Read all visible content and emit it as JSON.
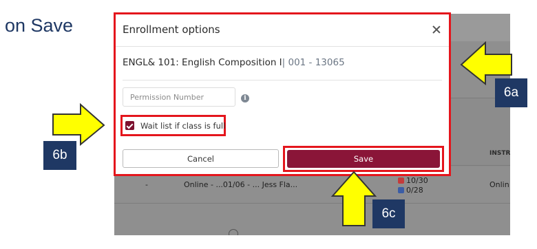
{
  "caption": {
    "text": "k on Save"
  },
  "background": {
    "column_header": "INSTR",
    "row": {
      "dash": "-",
      "info": "Online - ...01/06 - ... Jess Fla...",
      "seats_top": "10/30",
      "seats_bottom": "0/28",
      "mode": "Onlin"
    }
  },
  "modal": {
    "title": "Enrollment options",
    "course_name": "ENGL& 101: English Composition I",
    "section": "| 001 - 13065",
    "permission_placeholder": "Permission Number",
    "waitlist_label": "Wait list if class is full",
    "waitlist_checked": true,
    "cancel_label": "Cancel",
    "save_label": "Save"
  },
  "annotations": {
    "badge_6a": "6a",
    "badge_6b": "6b",
    "badge_6c": "6c",
    "arrow_color": "#ffff00",
    "highlight_color": "#e4151c",
    "badge_color": "#1f3864"
  },
  "colors": {
    "primary": "#8a1538"
  }
}
